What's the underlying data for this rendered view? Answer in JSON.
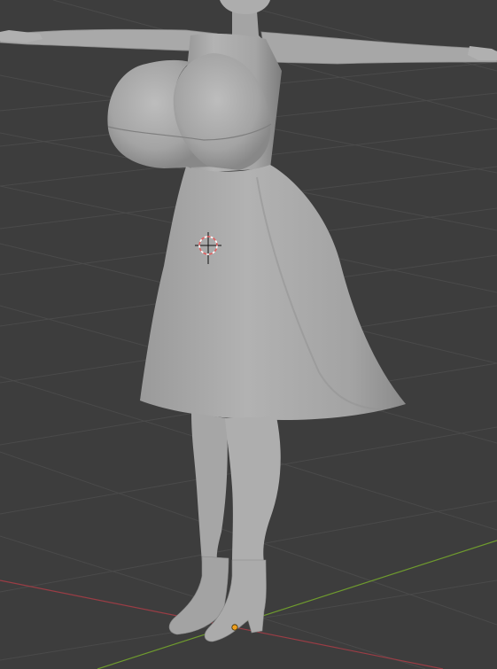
{
  "viewport": {
    "background": "#3d3d3d",
    "grid_color": "#4a4a4a",
    "x_axis_color": "#9a3d45",
    "y_axis_color": "#6f9b2e",
    "model_color": "#a8a8a8",
    "cursor_color": "#e06060",
    "origin_color": "#f0a020"
  },
  "scene": {
    "object": "character-model",
    "pose": "T-pose",
    "shading": "solid"
  },
  "tools": {
    "cursor_icon": "3d-cursor-icon",
    "origin_icon": "object-origin-icon"
  }
}
